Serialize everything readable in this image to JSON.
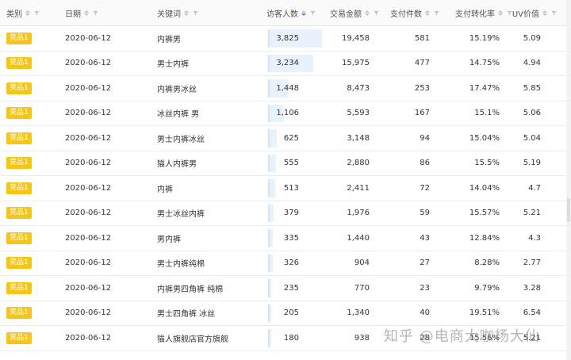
{
  "columns": [
    {
      "label": "类别",
      "sort_active": false
    },
    {
      "label": "日期",
      "sort_active": false
    },
    {
      "label": "关键词",
      "sort_active": false
    },
    {
      "label": "访客人数",
      "sort_active": true
    },
    {
      "label": "交易金额",
      "sort_active": false
    },
    {
      "label": "支付件数",
      "sort_active": false
    },
    {
      "label": "支付转化率",
      "sort_active": false
    },
    {
      "label": "UV价值",
      "sort_active": false
    }
  ],
  "colors": {
    "badge": "#f5c518",
    "bar": "#e8f2fc",
    "sort_active": "#3b82f6"
  },
  "visitor_max": 3825,
  "rows": [
    {
      "cat": "竞品1",
      "date": "2020-06-12",
      "keyword": "内裤男",
      "visitors": "3,825",
      "visitors_num": 3825,
      "amount": "19,458",
      "qty": "581",
      "rate": "15.19%",
      "uv": "5.09"
    },
    {
      "cat": "竞品1",
      "date": "2020-06-12",
      "keyword": "男士内裤",
      "visitors": "3,234",
      "visitors_num": 3234,
      "amount": "15,975",
      "qty": "477",
      "rate": "14.75%",
      "uv": "4.94"
    },
    {
      "cat": "竞品1",
      "date": "2020-06-12",
      "keyword": "内裤男冰丝",
      "visitors": "1,448",
      "visitors_num": 1448,
      "amount": "8,473",
      "qty": "253",
      "rate": "17.47%",
      "uv": "5.85"
    },
    {
      "cat": "竞品1",
      "date": "2020-06-12",
      "keyword": "冰丝内裤 男",
      "visitors": "1,106",
      "visitors_num": 1106,
      "amount": "5,593",
      "qty": "167",
      "rate": "15.1%",
      "uv": "5.06"
    },
    {
      "cat": "竞品1",
      "date": "2020-06-12",
      "keyword": "男士内裤冰丝",
      "visitors": "625",
      "visitors_num": 625,
      "amount": "3,148",
      "qty": "94",
      "rate": "15.04%",
      "uv": "5.04"
    },
    {
      "cat": "竞品1",
      "date": "2020-06-12",
      "keyword": "猫人内裤男",
      "visitors": "555",
      "visitors_num": 555,
      "amount": "2,880",
      "qty": "86",
      "rate": "15.5%",
      "uv": "5.19"
    },
    {
      "cat": "竞品1",
      "date": "2020-06-12",
      "keyword": "内裤",
      "visitors": "513",
      "visitors_num": 513,
      "amount": "2,411",
      "qty": "72",
      "rate": "14.04%",
      "uv": "4.7"
    },
    {
      "cat": "竞品1",
      "date": "2020-06-12",
      "keyword": "男士冰丝内裤",
      "visitors": "379",
      "visitors_num": 379,
      "amount": "1,976",
      "qty": "59",
      "rate": "15.57%",
      "uv": "5.21"
    },
    {
      "cat": "竞品1",
      "date": "2020-06-12",
      "keyword": "男内裤",
      "visitors": "335",
      "visitors_num": 335,
      "amount": "1,440",
      "qty": "43",
      "rate": "12.84%",
      "uv": "4.3"
    },
    {
      "cat": "竞品1",
      "date": "2020-06-12",
      "keyword": "男士内裤纯棉",
      "visitors": "326",
      "visitors_num": 326,
      "amount": "904",
      "qty": "27",
      "rate": "8.28%",
      "uv": "2.77"
    },
    {
      "cat": "竞品1",
      "date": "2020-06-12",
      "keyword": "内裤男四角裤 纯棉",
      "visitors": "235",
      "visitors_num": 235,
      "amount": "770",
      "qty": "23",
      "rate": "9.79%",
      "uv": "3.28"
    },
    {
      "cat": "竞品1",
      "date": "2020-06-12",
      "keyword": "男士四角裤 冰丝",
      "visitors": "205",
      "visitors_num": 205,
      "amount": "1,340",
      "qty": "40",
      "rate": "19.51%",
      "uv": "6.54"
    },
    {
      "cat": "竞品1",
      "date": "2020-06-12",
      "keyword": "猫人旗舰店官方旗舰",
      "visitors": "180",
      "visitors_num": 180,
      "amount": "938",
      "qty": "28",
      "rate": "15.56%",
      "uv": "5.21"
    }
  ],
  "watermark": "知乎 @电商大咖杨大仙"
}
